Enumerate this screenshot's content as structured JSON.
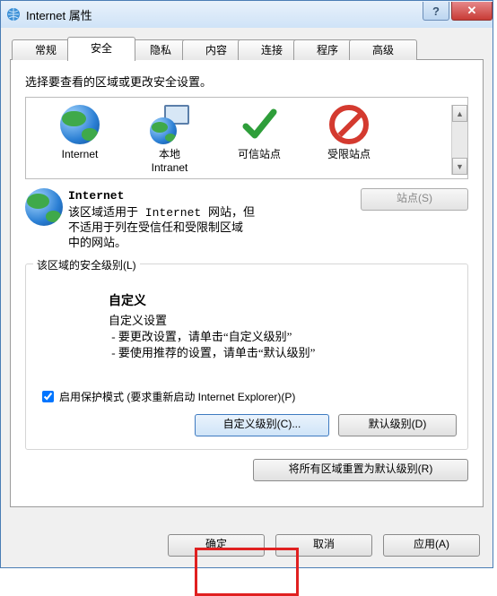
{
  "window": {
    "title": "Internet 属性"
  },
  "tabs": [
    "常规",
    "安全",
    "隐私",
    "内容",
    "连接",
    "程序",
    "高级"
  ],
  "active_tab_index": 1,
  "security": {
    "prompt": "选择要查看的区域或更改安全设置。",
    "zones": [
      {
        "label": "Internet"
      },
      {
        "label_line1": "本地",
        "label_line2": "Intranet"
      },
      {
        "label": "可信站点"
      },
      {
        "label": "受限站点"
      }
    ],
    "selected_zone": {
      "name": "Internet",
      "desc_l1": "该区域适用于 Internet 网站，但",
      "desc_l2": "不适用于列在受信任和受限制区域",
      "desc_l3": "中的网站。"
    },
    "sites_button": "站点(S)",
    "group_legend": "该区域的安全级别(L)",
    "level_name": "自定义",
    "level_sub": "自定义设置",
    "level_b1": "- 要更改设置，请单击“自定义级别”",
    "level_b2": "- 要使用推荐的设置，请单击“默认级别”",
    "protected_mode": "启用保护模式 (要求重新启动 Internet Explorer)(P)",
    "btn_custom": "自定义级别(C)...",
    "btn_default": "默认级别(D)",
    "btn_reset": "将所有区域重置为默认级别(R)"
  },
  "footer": {
    "ok": "确定",
    "cancel": "取消",
    "apply": "应用(A)"
  }
}
